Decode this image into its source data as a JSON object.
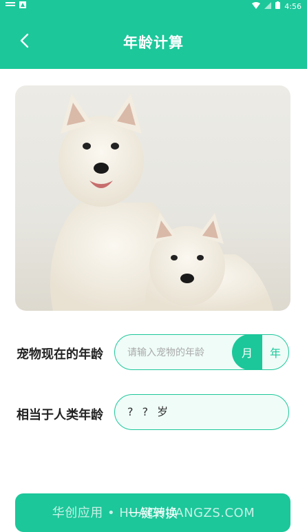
{
  "status_bar": {
    "time": "4:56"
  },
  "header": {
    "title": "年龄计算"
  },
  "pet_age": {
    "label": "宠物现在的年龄",
    "placeholder": "请输入宠物的年龄",
    "unit_month": "月",
    "unit_year": "年"
  },
  "human_age": {
    "label": "相当于人类年龄",
    "value": "? ? 岁"
  },
  "actions": {
    "convert_label": "一键转换"
  },
  "watermark": "华创应用 • HUACHUANGZS.COM",
  "colors": {
    "accent": "#1cc79a",
    "field_bg": "#effcf8"
  }
}
